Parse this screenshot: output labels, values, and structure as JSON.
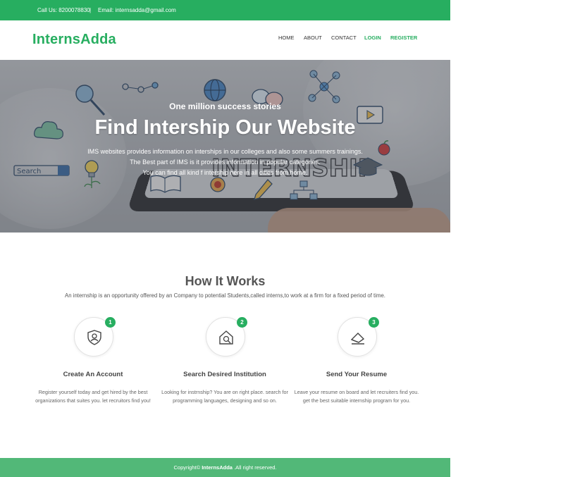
{
  "topbar": {
    "phone": "Call Us: 8200078830",
    "separator": "|",
    "email": "Email: internsadda@gmail.com"
  },
  "header": {
    "logo": "InternsAdda",
    "nav": [
      {
        "label": "HOME"
      },
      {
        "label": "ABOUT"
      },
      {
        "label": "CONTACT"
      },
      {
        "label": "LOGIN"
      },
      {
        "label": "REGISTER"
      }
    ]
  },
  "hero": {
    "subtitle": "One million success stories",
    "title": "Find Intership Our Website",
    "lines": [
      "IMS websites provides information on interships in our colleges and also some summers trainings.",
      "The Best part of IMS is it provides information in popular categories.",
      "You can find all kind f intership here in all cities from home."
    ],
    "doodle_words": {
      "search": "Search",
      "internship": "INTERNSHIP"
    }
  },
  "how_it_works": {
    "title": "How It Works",
    "description": "An internship is an opportunity offered by an Company to potential Students,called interns,to work at a firm for a fixed period of time.",
    "steps": [
      {
        "number": "1",
        "icon": "shield-user-icon",
        "title": "Create An Account",
        "text": "Register yourself today and get hired by the best organizations that suites you. let recruitors find you!"
      },
      {
        "number": "2",
        "icon": "house-search-icon",
        "title": "Search Desired Institution",
        "text": "Looking for instrnship? You are on right place. search for programming languages, designing and so on."
      },
      {
        "number": "3",
        "icon": "send-envelope-icon",
        "title": "Send Your Resume",
        "text": "Leave your resume on board and let recruiters find you. get the best suitable internship program for you."
      }
    ]
  },
  "footer": {
    "prefix": "Copyright©",
    "brand": "InternsAdda",
    "suffix": ".All right reserved."
  },
  "colors": {
    "brand_green": "#27ae60",
    "footer_green": "#52b878"
  }
}
